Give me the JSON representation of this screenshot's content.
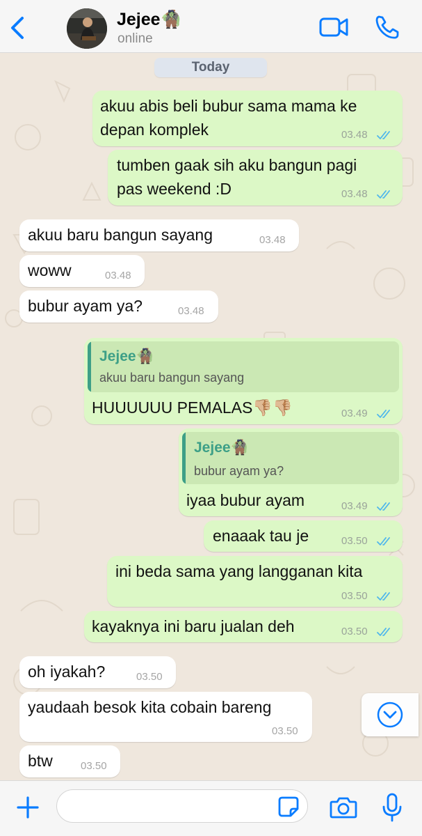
{
  "header": {
    "contact_name": "Jejee",
    "contact_emoji": "🧌",
    "status": "online"
  },
  "chat": {
    "date_label": "Today",
    "messages": [
      {
        "dir": "out",
        "lines": [
          "akuu abis beli bubur sama mama ke",
          "depan komplek"
        ],
        "time": "03.48",
        "read": true
      },
      {
        "dir": "out",
        "lines": [
          "tumben gaak sih aku bangun pagi",
          "pas weekend :D"
        ],
        "time": "03.48",
        "read": true
      },
      {
        "dir": "in",
        "lines": [
          "akuu baru bangun sayang"
        ],
        "time": "03.48"
      },
      {
        "dir": "in",
        "lines": [
          "woww"
        ],
        "time": "03.48"
      },
      {
        "dir": "in",
        "lines": [
          "bubur ayam ya?"
        ],
        "time": "03.48"
      },
      {
        "dir": "out",
        "reply_to": {
          "name": "Jejee",
          "emoji": "🧌",
          "text": "akuu baru bangun sayang"
        },
        "lines": [
          "HUUUUUU PEMALAS👎🏼👎🏼"
        ],
        "time": "03.49",
        "read": true
      },
      {
        "dir": "out",
        "reply_to": {
          "name": "Jejee",
          "emoji": "🧌",
          "text": "bubur ayam ya?"
        },
        "lines": [
          "iyaa bubur ayam"
        ],
        "time": "03.49",
        "read": true
      },
      {
        "dir": "out",
        "lines": [
          "enaaak tau je"
        ],
        "time": "03.50",
        "read": true
      },
      {
        "dir": "out",
        "lines": [
          "ini beda sama yang langganan kita"
        ],
        "time": "03.50",
        "read": true
      },
      {
        "dir": "out",
        "lines": [
          "kayaknya ini baru jualan deh"
        ],
        "time": "03.50",
        "read": true
      },
      {
        "dir": "in",
        "lines": [
          "oh iyakah?"
        ],
        "time": "03.50"
      },
      {
        "dir": "in",
        "lines": [
          "yaudaah besok kita cobain bareng"
        ],
        "time": "03.50"
      },
      {
        "dir": "in",
        "lines": [
          "btw"
        ],
        "time": "03.50"
      }
    ]
  },
  "input": {
    "placeholder": "",
    "value": ""
  },
  "icons": {
    "back": "chevron-left-icon",
    "video": "video-camera-icon",
    "call": "phone-icon",
    "add": "plus-icon",
    "sticker": "sticker-icon",
    "camera": "camera-icon",
    "mic": "microphone-icon",
    "scroll": "chevron-down-circle-icon"
  },
  "colors": {
    "accent": "#0a7cff",
    "outgoing_bubble": "#dcf8c6",
    "incoming_bubble": "#ffffff",
    "quote_name": "#3d9f87",
    "read_ticks": "#4fb6ec",
    "wallpaper": "#efe7dd"
  }
}
